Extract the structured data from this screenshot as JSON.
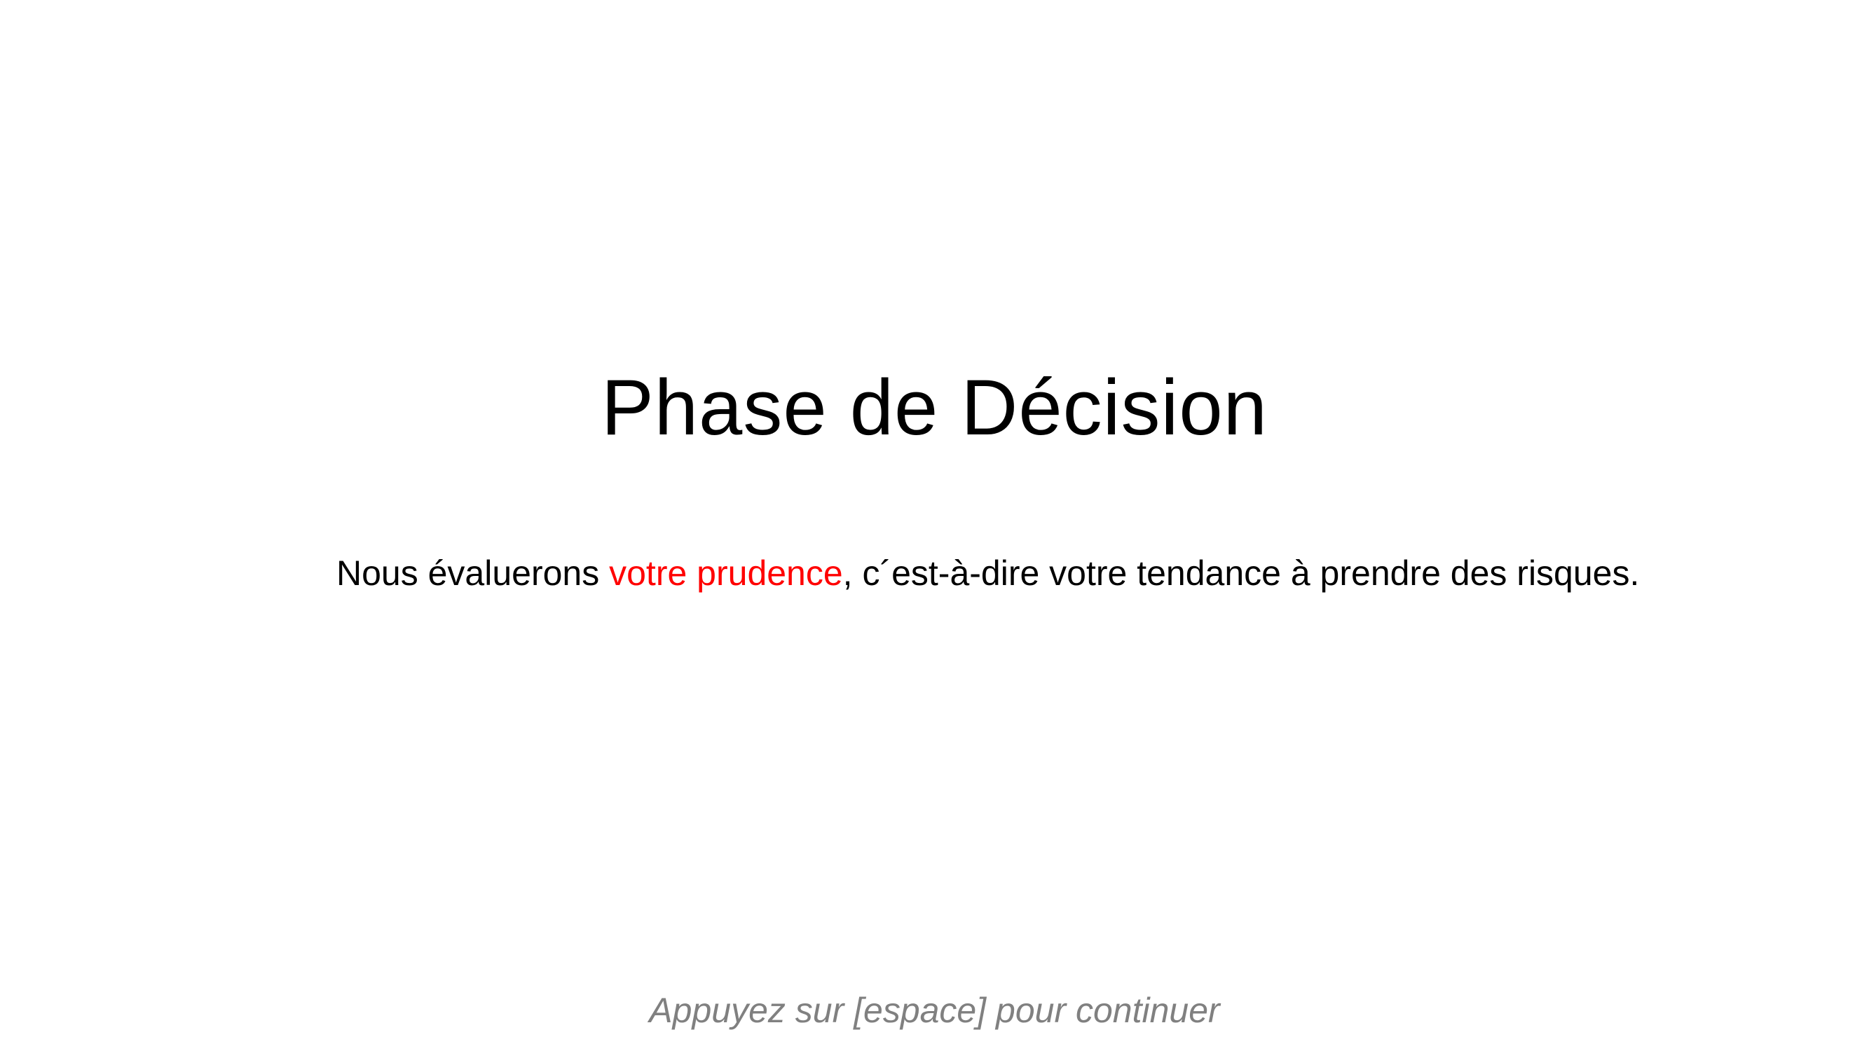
{
  "slide": {
    "title": "Phase de Décision",
    "body": {
      "part1": "Nous évaluerons ",
      "highlight": "votre prudence",
      "part2": ", c´est-à-dire votre tendance à prendre des risques."
    },
    "hint": "Appuyez sur [espace] pour continuer"
  },
  "colors": {
    "background": "#ffffff",
    "text": "#000000",
    "highlight": "#ff0000",
    "hint": "#808080"
  }
}
